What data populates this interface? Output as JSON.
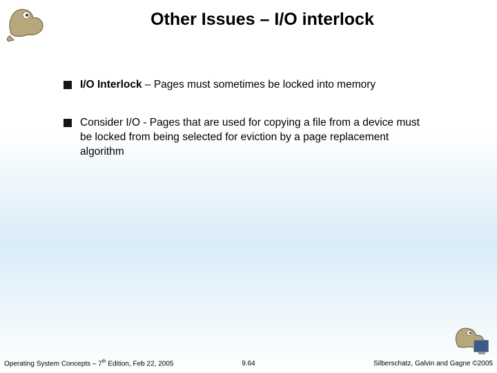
{
  "title": "Other Issues – I/O interlock",
  "bullets": [
    {
      "bold": "I/O Interlock",
      "rest": " – Pages must sometimes be locked into memory"
    },
    {
      "bold": "",
      "rest": "Consider I/O - Pages that are used for copying a file from a device must be locked from being selected for eviction by a page replacement algorithm"
    }
  ],
  "footer": {
    "left_prefix": "Operating System Concepts – 7",
    "left_sup": "th",
    "left_suffix": " Edition, Feb 22, 2005",
    "center": "9.64",
    "right": "Silberschatz, Galvin and Gagne ©2005"
  }
}
